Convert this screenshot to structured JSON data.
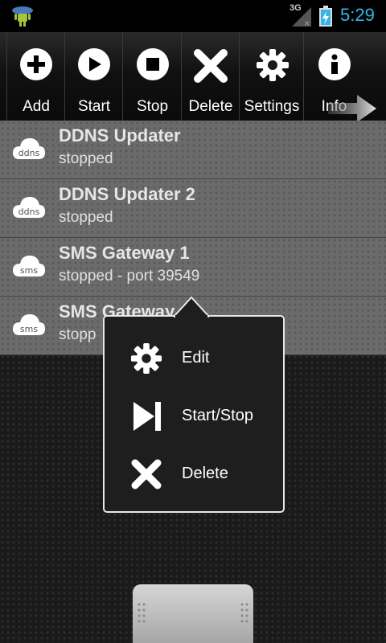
{
  "status_bar": {
    "network_label": "3G",
    "time": "5:29",
    "icons": [
      "android-notification-icon",
      "signal-icon",
      "battery-charging-icon"
    ]
  },
  "toolbar": {
    "buttons": [
      {
        "label": "Add",
        "icon": "add-icon"
      },
      {
        "label": "Start",
        "icon": "play-icon"
      },
      {
        "label": "Stop",
        "icon": "stop-icon"
      },
      {
        "label": "Delete",
        "icon": "delete-x-icon"
      },
      {
        "label": "Settings",
        "icon": "gear-icon"
      },
      {
        "label": "Info",
        "icon": "info-icon"
      }
    ],
    "overflow_icon": "arrow-right-icon"
  },
  "services": [
    {
      "title": "DDNS Updater",
      "status": "stopped",
      "icon_text": "ddns"
    },
    {
      "title": "DDNS Updater 2",
      "status": "stopped",
      "icon_text": "ddns"
    },
    {
      "title": "SMS Gateway 1",
      "status": "stopped - port 39549",
      "icon_text": "sms"
    },
    {
      "title": "SMS Gateway",
      "status": "stopp",
      "icon_text": "sms"
    }
  ],
  "context_menu": {
    "items": [
      {
        "label": "Edit",
        "icon": "gear-icon"
      },
      {
        "label": "Start/Stop",
        "icon": "skip-next-icon"
      },
      {
        "label": "Delete",
        "icon": "delete-x-icon"
      }
    ]
  },
  "colors": {
    "accent": "#33b5e5",
    "list_row": "#6b6b6b",
    "background": "#1a1a1a",
    "menu_bg": "#1e1e1e"
  }
}
